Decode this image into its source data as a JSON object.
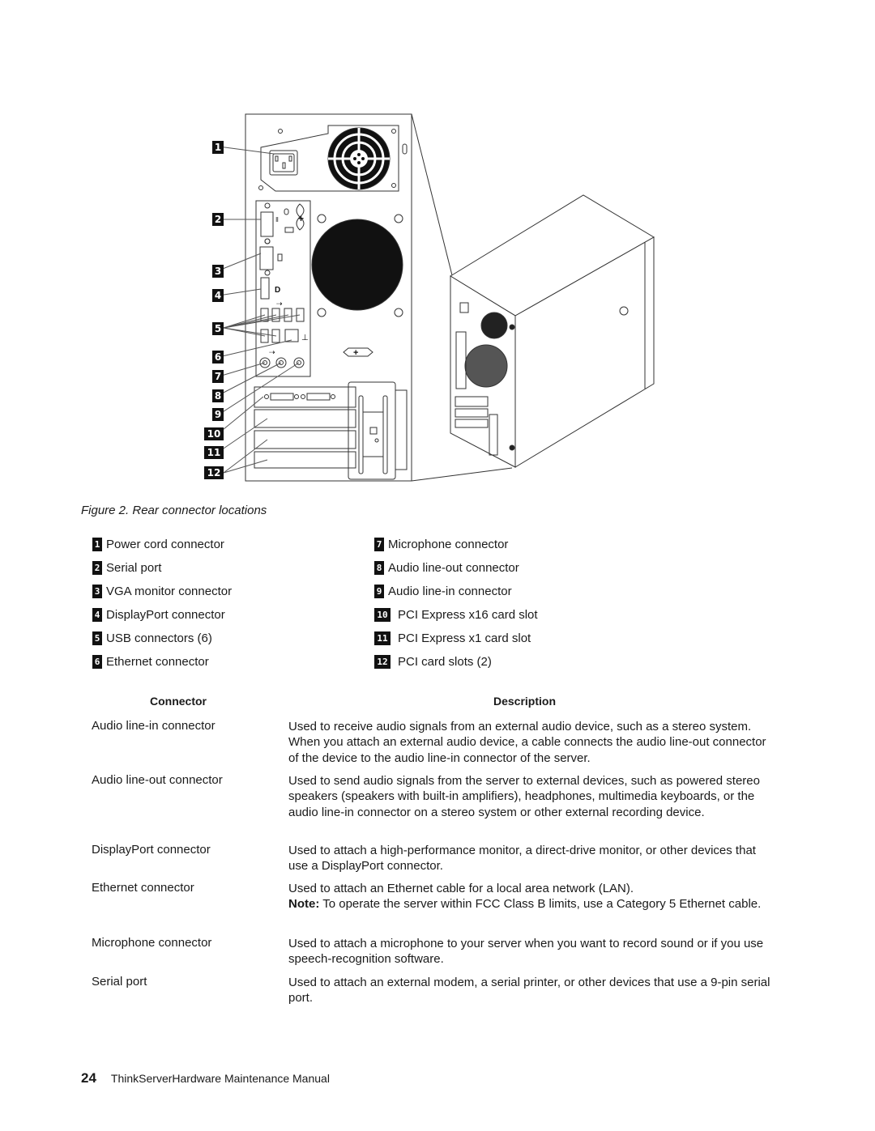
{
  "figure": {
    "caption": "Figure 2.  Rear connector locations",
    "callouts": [
      "1",
      "2",
      "3",
      "4",
      "5",
      "6",
      "7",
      "8",
      "9",
      "10",
      "11",
      "12"
    ]
  },
  "legend": {
    "left": [
      {
        "num": "1",
        "label": "Power cord connector"
      },
      {
        "num": "2",
        "label": "Serial port"
      },
      {
        "num": "3",
        "label": "VGA monitor connector"
      },
      {
        "num": "4",
        "label": "DisplayPort connector"
      },
      {
        "num": "5",
        "label": "USB connectors (6)"
      },
      {
        "num": "6",
        "label": "Ethernet connector"
      }
    ],
    "right": [
      {
        "num": "7",
        "label": "Microphone connector"
      },
      {
        "num": "8",
        "label": "Audio line-out connector"
      },
      {
        "num": "9",
        "label": "Audio line-in connector"
      },
      {
        "num": "10",
        "label": "PCI Express x16 card slot"
      },
      {
        "num": "11",
        "label": "PCI Express x1 card slot"
      },
      {
        "num": "12",
        "label": "PCI card slots (2)"
      }
    ]
  },
  "table": {
    "headers": {
      "connector": "Connector",
      "description": "Description"
    },
    "rows": [
      {
        "connector": "Audio line-in connector",
        "description": "Used to receive audio signals from an external audio device, such as a stereo system.  When you attach an external audio device, a cable connects the audio line-out connector of the device to the audio line-in connector of the server."
      },
      {
        "connector": "Audio line-out connector",
        "description": "Used to send audio signals from the server to external devices, such as powered stereo speakers (speakers with built-in amplifiers), headphones, multimedia keyboards, or the audio line-in connector on a stereo system or other external recording device."
      },
      {
        "connector": "DisplayPort connector",
        "description": "Used to attach a high-performance monitor, a direct-drive monitor, or other devices that use a DisplayPort connector."
      },
      {
        "connector": "Ethernet connector",
        "description": "Used to attach an Ethernet cable for a local area network (LAN).",
        "note_label": "Note:",
        "note": " To operate the server within FCC Class B limits, use a Category 5 Ethernet cable."
      },
      {
        "connector": "Microphone connector",
        "description": "Used to attach a microphone to your server when you want to record sound or if you use speech-recognition software."
      },
      {
        "connector": "Serial port",
        "description": "Used to attach an external modem, a serial printer, or other devices that use a 9-pin serial port."
      }
    ]
  },
  "footer": {
    "page_number": "24",
    "title": "ThinkServerHardware Maintenance Manual"
  }
}
